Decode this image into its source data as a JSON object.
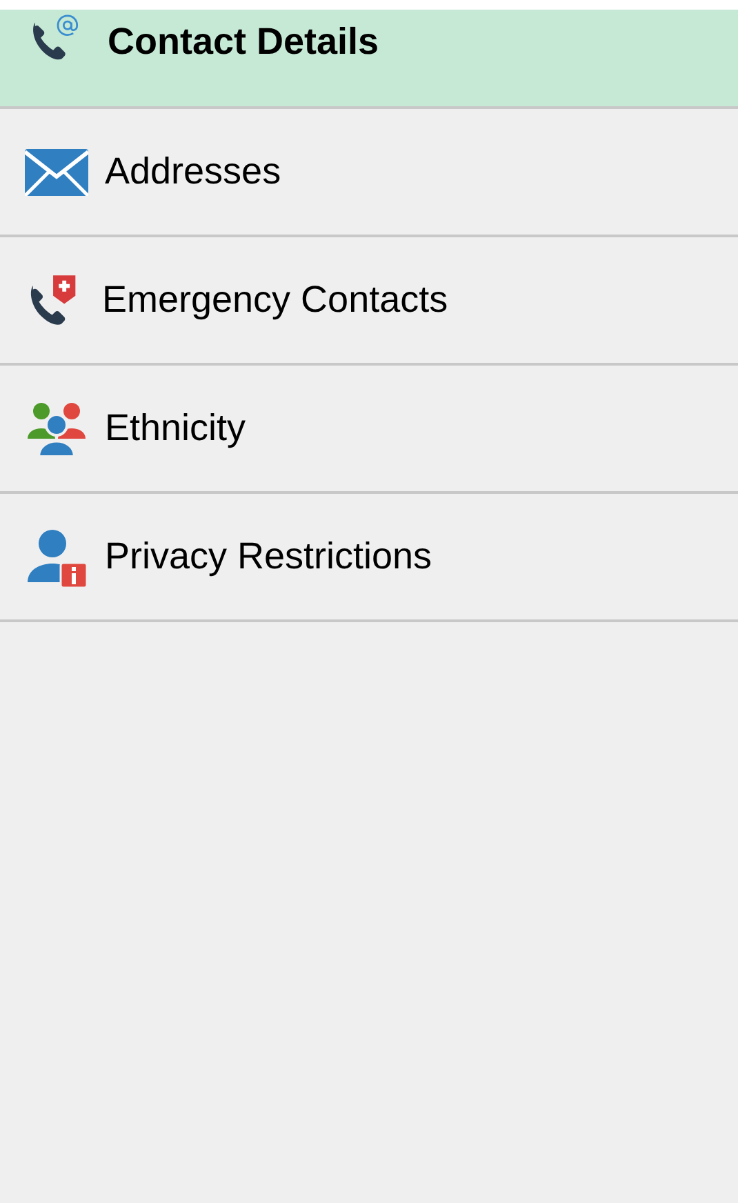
{
  "menu": [
    {
      "label": "Contact Details",
      "kind": "phone-at",
      "selected": true
    },
    {
      "label": "Addresses",
      "kind": "envelope",
      "selected": false
    },
    {
      "label": "Emergency Contacts",
      "kind": "phone-plus",
      "selected": false
    },
    {
      "label": "Ethnicity",
      "kind": "people",
      "selected": false
    },
    {
      "label": "Privacy Restrictions",
      "kind": "person-info",
      "selected": false
    }
  ]
}
